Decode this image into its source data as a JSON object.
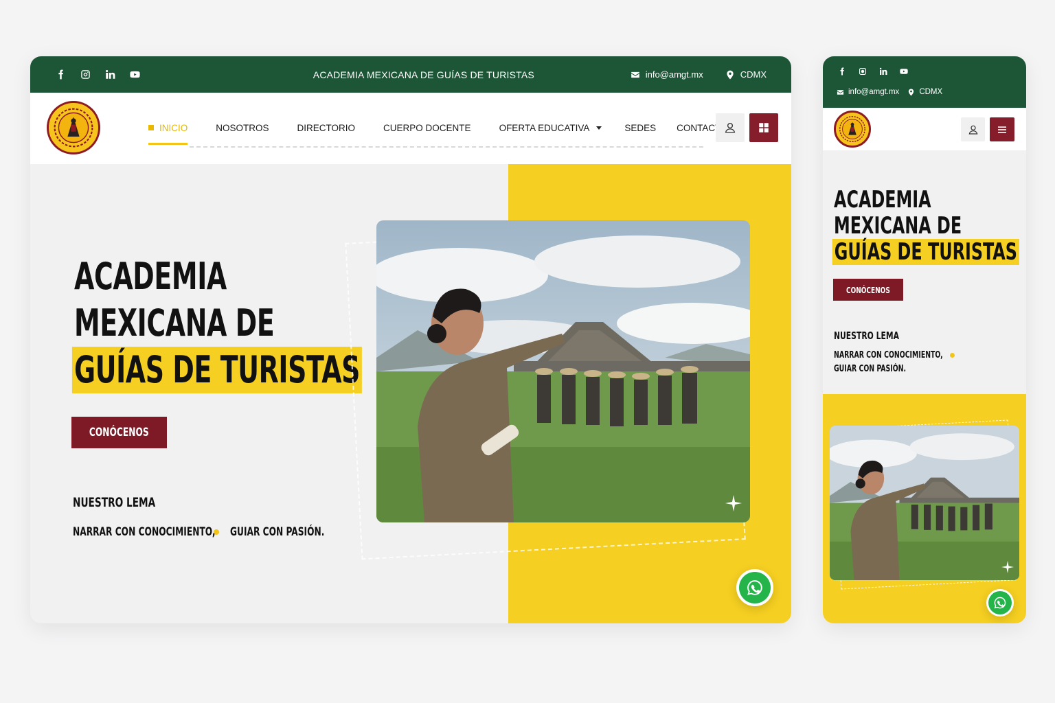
{
  "site": {
    "top_title": "ACADEMIA MEXICANA DE GUÍAS DE TURISTAS",
    "email": "info@amgt.mx",
    "location": "CDMX",
    "social": [
      "facebook-icon",
      "instagram-icon",
      "linkedin-icon",
      "youtube-icon"
    ]
  },
  "nav": {
    "items": [
      {
        "label": "INICIO",
        "active": true
      },
      {
        "label": "NOSOTROS"
      },
      {
        "label": "DIRECTORIO"
      },
      {
        "label": "CUERPO DOCENTE"
      },
      {
        "label": "OFERTA EDUCATIVA",
        "dropdown": true
      },
      {
        "label": "SEDES"
      },
      {
        "label": "CONTACTO"
      }
    ]
  },
  "hero": {
    "title_line1": "ACADEMIA",
    "title_line2": "MEXICANA DE",
    "title_highlight": "GUÍAS DE TURISTAS",
    "mobile_title_line1": "ACADEMIA",
    "mobile_title_line2": "MEXICANA DE",
    "cta": "CONÓCENOS",
    "motto_heading": "NUESTRO LEMA",
    "motto_part1": "NARRAR CON CONOCIMIENTO,",
    "motto_part2": "GUIAR CON PASIÓN."
  },
  "colors": {
    "green": "#1c5637",
    "maroon": "#7e1a25",
    "yellow": "#f5cf21",
    "whatsapp": "#24b44a"
  }
}
